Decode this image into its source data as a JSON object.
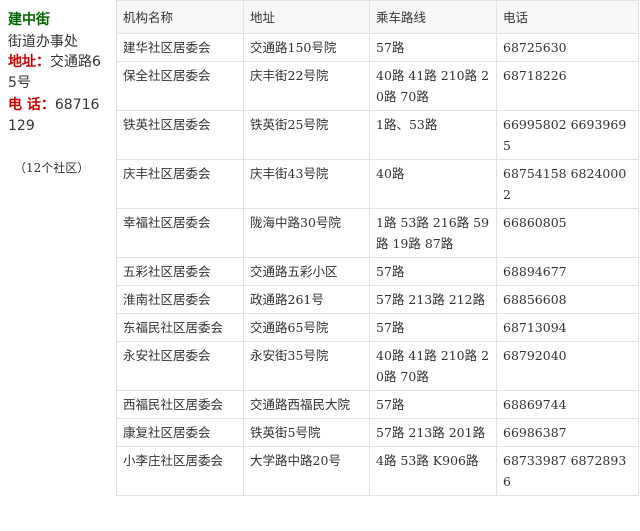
{
  "office": {
    "name": "建中街",
    "type": "街道办事处",
    "address_label": "地址：",
    "address": "交通路65号",
    "phone_label": "电 话：",
    "phone": "68716129",
    "community_count": "（12个社区）"
  },
  "table": {
    "headers": [
      "机构名称",
      "地址",
      "乘车路线",
      "电话"
    ],
    "rows": [
      [
        "建华社区居委会",
        "交通路150号院",
        "57路",
        "68725630"
      ],
      [
        "保全社区居委会",
        "庆丰街22号院",
        "40路 41路 210路 20路 70路",
        "68718226"
      ],
      [
        "铁英社区居委会",
        "铁英街25号院",
        "1路、53路",
        "66995802 66939695"
      ],
      [
        "庆丰社区居委会",
        "庆丰街43号院",
        "40路",
        "68754158 68240002"
      ],
      [
        "幸福社区居委会",
        "陇海中路30号院",
        "1路 53路 216路 59路 19路 87路",
        "66860805"
      ],
      [
        "五彩社区居委会",
        "交通路五彩小区",
        "57路",
        "68894677"
      ],
      [
        "淮南社区居委会",
        "政通路261号",
        "57路 213路 212路",
        "68856608"
      ],
      [
        "东福民社区居委会",
        "交通路65号院",
        "57路",
        "68713094"
      ],
      [
        "永安社区居委会",
        "永安街35号院",
        "40路 41路 210路 20路 70路",
        "68792040"
      ],
      [
        "西福民社区居委会",
        "交通路西福民大院",
        "57路",
        "68869744"
      ],
      [
        "康复社区居委会",
        "铁英街5号院",
        "57路 213路 201路",
        "66986387"
      ],
      [
        "小李庄社区居委会",
        "大学路中路20号",
        "4路 53路 K906路",
        "68733987 68728936"
      ]
    ]
  }
}
